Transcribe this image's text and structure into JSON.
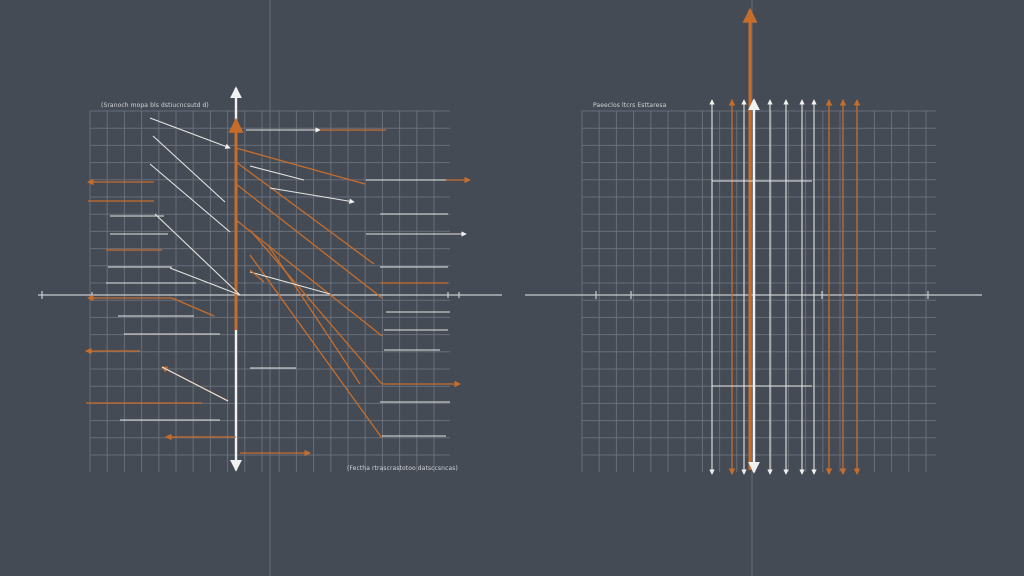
{
  "colors": {
    "background": "#454b55",
    "grid": "#6f7580",
    "accent_orange": "#c66d2c",
    "vector_white": "#f1f1ef"
  },
  "left_panel": {
    "caption_top": "(Sranoch mopa bls dstiucncsutd d)",
    "caption_bottom": "(Fectha rtrascrastotoo datsccsncas)"
  },
  "right_panel": {
    "caption_top": "Paeeclos ltcrs Esttaresa"
  }
}
